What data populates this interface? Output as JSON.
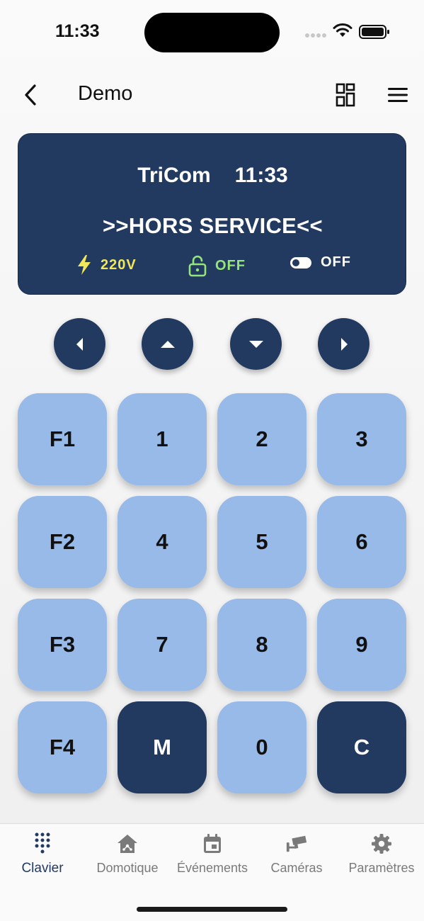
{
  "status_bar": {
    "time": "11:33"
  },
  "header": {
    "title": "Demo"
  },
  "display": {
    "brand": "TriCom",
    "clock": "11:33",
    "message": ">>HORS SERVICE<<",
    "power": {
      "icon": "bolt-icon",
      "value": "220V",
      "color": "#f0e85a"
    },
    "lock": {
      "icon": "unlock-icon",
      "value": "OFF",
      "color": "#94e57a"
    },
    "toggle": {
      "icon": "toggle-icon",
      "value": "OFF",
      "color": "#ffffff"
    }
  },
  "nav_arrows": [
    "left",
    "up",
    "down",
    "right"
  ],
  "keypad": {
    "rows": [
      [
        "F1",
        "1",
        "2",
        "3"
      ],
      [
        "F2",
        "4",
        "5",
        "6"
      ],
      [
        "F3",
        "7",
        "8",
        "9"
      ],
      [
        "F4",
        "M",
        "0",
        "C"
      ]
    ]
  },
  "tabs": [
    {
      "label": "Clavier",
      "icon": "keypad-icon",
      "active": true
    },
    {
      "label": "Domotique",
      "icon": "smart-home-icon",
      "active": false
    },
    {
      "label": "Événements",
      "icon": "calendar-icon",
      "active": false
    },
    {
      "label": "Caméras",
      "icon": "camera-icon",
      "active": false
    },
    {
      "label": "Paramètres",
      "icon": "gear-icon",
      "active": false
    }
  ],
  "colors": {
    "primary_dark": "#233a60",
    "key_light": "#97bae9",
    "tab_active": "#233a60",
    "tab_inactive": "#7a7a7a"
  }
}
